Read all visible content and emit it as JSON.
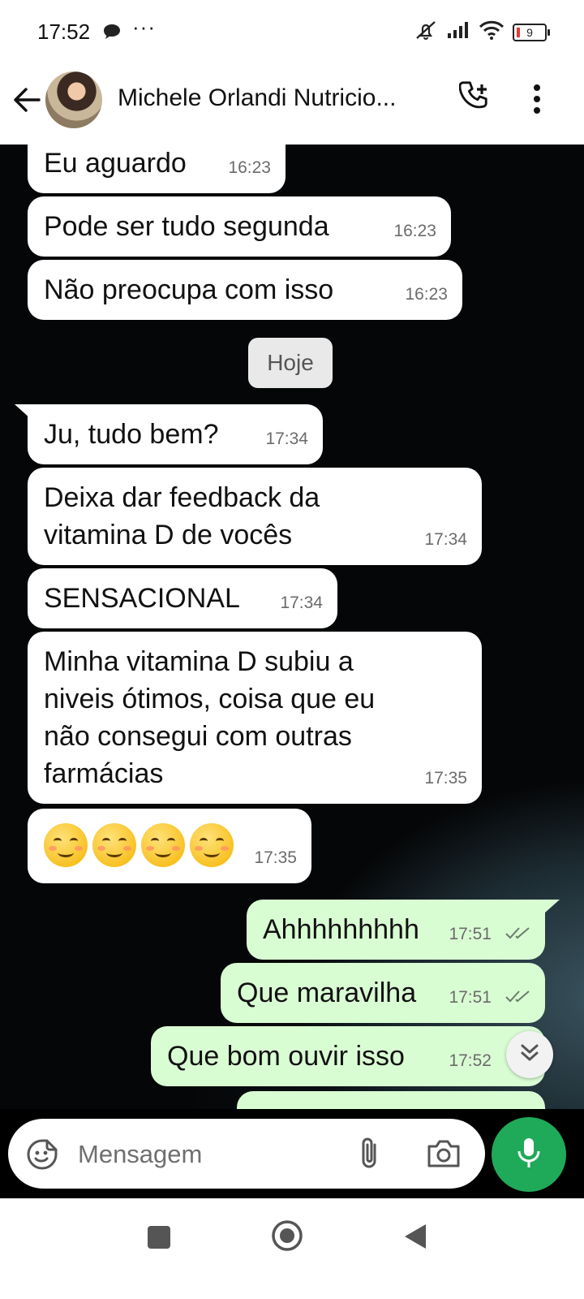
{
  "status_bar": {
    "time": "17:52",
    "more": "···",
    "battery": "9"
  },
  "header": {
    "contact_name": "Michele Orlandi Nutricio..."
  },
  "chat": {
    "day_label": "Hoje",
    "messages": [
      {
        "text": "Eu aguardo",
        "time": "16:23"
      },
      {
        "text": "Pode ser tudo segunda",
        "time": "16:23"
      },
      {
        "text": "Não preocupa com isso",
        "time": "16:23"
      },
      {
        "text": "Ju, tudo bem?",
        "time": "17:34"
      },
      {
        "line1": "Deixa dar feedback da",
        "line2": "vitamina D de vocês",
        "time": "17:34"
      },
      {
        "text": "SENSACIONAL",
        "time": "17:34"
      },
      {
        "line1": "Minha vitamina D subiu a",
        "line2": "niveis ótimos, coisa que eu",
        "line3": "não consegui com outras",
        "line4": "farmácias",
        "time": "17:35"
      },
      {
        "emoji": "☺☺☺☺",
        "time": "17:35"
      },
      {
        "text": "Ahhhhhhhhh",
        "time": "17:51"
      },
      {
        "text": "Que maravilha",
        "time": "17:51"
      },
      {
        "text": "Que bom ouvir isso",
        "time": "17:52"
      }
    ]
  },
  "input": {
    "placeholder": "Mensagem"
  },
  "icons": {
    "back": "arrow-left-icon",
    "call_add": "phone-plus-icon",
    "menu": "more-vert-icon",
    "emoji": "sticker-icon",
    "attach": "paperclip-icon",
    "camera": "camera-icon",
    "mic": "microphone-icon",
    "scroll": "double-chevron-down-icon"
  },
  "colors": {
    "accent": "#1faa59",
    "outgoing_bubble": "#d9fdd3",
    "incoming_bubble": "#ffffff"
  }
}
